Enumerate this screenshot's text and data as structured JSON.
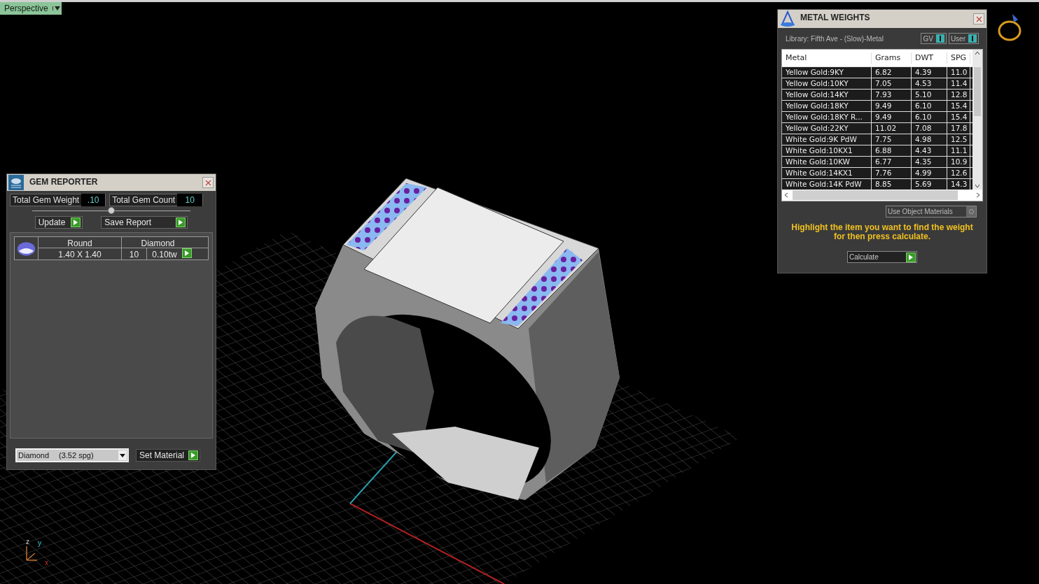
{
  "viewport": {
    "view_menu": "Perspective",
    "axes": [
      "z",
      "y",
      "x"
    ]
  },
  "gem_reporter": {
    "title": "GEM REPORTER",
    "total_weight": {
      "label": "Total Gem Weight",
      "value": ".10"
    },
    "total_count": {
      "label": "Total Gem Count",
      "value": "10"
    },
    "buttons": [
      "Update",
      "Save Report"
    ],
    "gems": [
      {
        "shape": "Round",
        "material": "Diamond",
        "size": "1.40 X 1.40",
        "count": "10",
        "weight": "0.10tw"
      }
    ],
    "material_select": {
      "value": "Diamond",
      "spg": "(3.52 spg)"
    },
    "set_button": "Set Material"
  },
  "metal_weights": {
    "title": "METAL WEIGHTS",
    "library": "Library: Fifth Ave - (Slow)-Metal",
    "toggles": [
      {
        "label": "GV",
        "on": true
      },
      {
        "label": "User",
        "on": true
      }
    ],
    "table": {
      "columns": [
        "Metal",
        "Grams",
        "DWT",
        "SPG"
      ],
      "rows": [
        [
          "Yellow Gold:9KY",
          "6.82",
          "4.39",
          "11.0"
        ],
        [
          "Yellow Gold:10KY",
          "7.05",
          "4.53",
          "11.4"
        ],
        [
          "Yellow Gold:14KY",
          "7.93",
          "5.10",
          "12.8"
        ],
        [
          "Yellow Gold:18KY",
          "9.49",
          "6.10",
          "15.4"
        ],
        [
          "Yellow Gold:18KY R...",
          "9.49",
          "6.10",
          "15.4"
        ],
        [
          "Yellow Gold:22KY",
          "11.02",
          "7.08",
          "17.8"
        ],
        [
          "White Gold:9K PdW",
          "7.75",
          "4.98",
          "12.5"
        ],
        [
          "White Gold:10KX1",
          "6.88",
          "4.43",
          "11.1"
        ],
        [
          "White Gold:10KW",
          "6.77",
          "4.35",
          "10.9"
        ],
        [
          "White Gold:14KX1",
          "7.76",
          "4.99",
          "12.6"
        ],
        [
          "White Gold:14K PdW",
          "8.85",
          "5.69",
          "14.3"
        ]
      ]
    },
    "use_object_materials": {
      "label": "Use Object Materials",
      "checked": false
    },
    "hint": "Highlight the item you want to find the weight for then press calculate.",
    "calculate_button": "Calculate"
  }
}
